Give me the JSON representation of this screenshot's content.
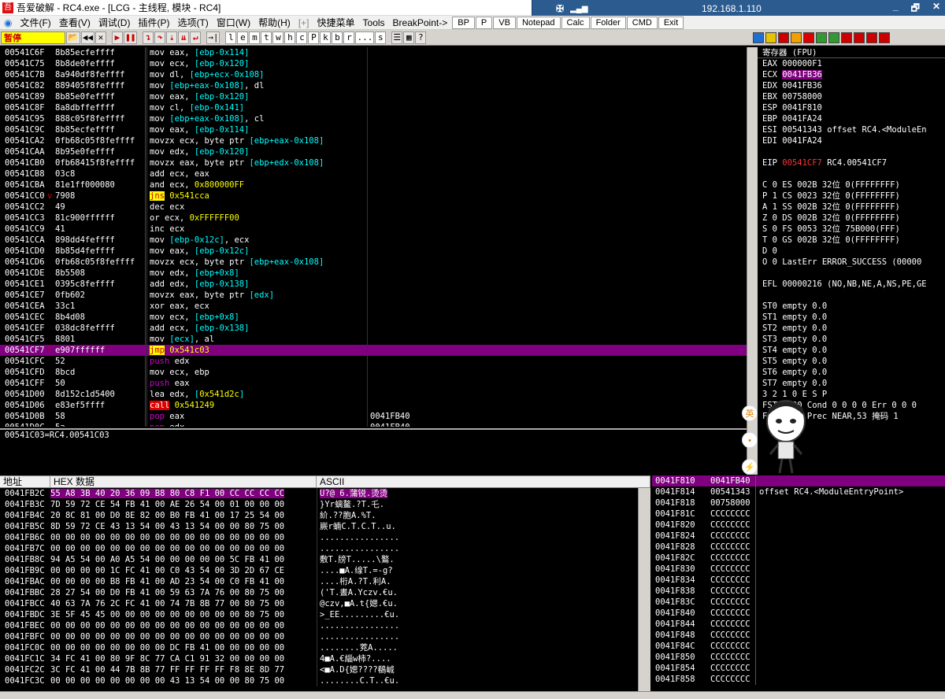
{
  "window": {
    "title": "吾爱破解 - RC4.exe - [LCG - 主线程, 模块 - RC4]",
    "app_icon": "吾"
  },
  "rdp": {
    "pin_icon": "pin-icon",
    "ip": "192.168.1.110",
    "minimize": "_",
    "restore": "🗗",
    "close": "✕"
  },
  "menu": {
    "items": [
      "文件(F)",
      "查看(V)",
      "调试(D)",
      "插件(P)",
      "选项(T)",
      "窗口(W)",
      "帮助(H)",
      "[+]",
      "快捷菜单",
      "Tools",
      "BreakPoint->"
    ],
    "quick_buttons": [
      "BP",
      "P",
      "VB",
      "Notepad",
      "Calc",
      "Folder",
      "CMD",
      "Exit"
    ]
  },
  "toolbar": {
    "status": "暂停",
    "letters": [
      "l",
      "e",
      "m",
      "t",
      "w",
      "h",
      "c",
      "P",
      "k",
      "b",
      "r",
      "...",
      "s"
    ]
  },
  "disasm": [
    {
      "addr": "00541C6F",
      "hex": "8b85ecfeffff",
      "mn": "mov",
      "ops": "eax, [ebp-0x114]"
    },
    {
      "addr": "00541C75",
      "hex": "8b8de0feffff",
      "mn": "mov",
      "ops": "ecx, [ebp-0x120]"
    },
    {
      "addr": "00541C7B",
      "hex": "8a940df8feffff",
      "mn": "mov",
      "ops": "dl, [ebp+ecx-0x108]"
    },
    {
      "addr": "00541C82",
      "hex": "889405f8feffff",
      "mn": "mov",
      "ops": "[ebp+eax-0x108], dl"
    },
    {
      "addr": "00541C89",
      "hex": "8b85e0feffff",
      "mn": "mov",
      "ops": "eax, [ebp-0x120]"
    },
    {
      "addr": "00541C8F",
      "hex": "8a8dbffeffff",
      "mn": "mov",
      "ops": "cl, [ebp-0x141]"
    },
    {
      "addr": "00541C95",
      "hex": "888c05f8feffff",
      "mn": "mov",
      "ops": "[ebp+eax-0x108], cl"
    },
    {
      "addr": "00541C9C",
      "hex": "8b85ecfeffff",
      "mn": "mov",
      "ops": "eax, [ebp-0x114]"
    },
    {
      "addr": "00541CA2",
      "hex": "0fb68c05f8feffff",
      "mn": "movzx",
      "ops": "ecx, byte ptr [ebp+eax-0x108]"
    },
    {
      "addr": "00541CAA",
      "hex": "8b95e0feffff",
      "mn": "mov",
      "ops": "edx, [ebp-0x120]"
    },
    {
      "addr": "00541CB0",
      "hex": "0fb68415f8feffff",
      "mn": "movzx",
      "ops": "eax, byte ptr [ebp+edx-0x108]"
    },
    {
      "addr": "00541CB8",
      "hex": "03c8",
      "mn": "add",
      "ops": "ecx, eax"
    },
    {
      "addr": "00541CBA",
      "hex": "81e1ff000080",
      "mn": "and",
      "ops": "ecx, 0x800000FF"
    },
    {
      "addr": "00541CC0",
      "hex": "7908",
      "mn": "jns",
      "ops": "0x541cca",
      "mark": "v"
    },
    {
      "addr": "00541CC2",
      "hex": "49",
      "mn": "dec",
      "ops": "ecx"
    },
    {
      "addr": "00541CC3",
      "hex": "81c900ffffff",
      "mn": "or",
      "ops": "ecx, 0xFFFFFF00"
    },
    {
      "addr": "00541CC9",
      "hex": "41",
      "mn": "inc",
      "ops": "ecx"
    },
    {
      "addr": "00541CCA",
      "hex": "898dd4feffff",
      "mn": "mov",
      "ops": "[ebp-0x12c], ecx"
    },
    {
      "addr": "00541CD0",
      "hex": "8b85d4feffff",
      "mn": "mov",
      "ops": "eax, [ebp-0x12c]"
    },
    {
      "addr": "00541CD6",
      "hex": "0fb68c05f8feffff",
      "mn": "movzx",
      "ops": "ecx, byte ptr [ebp+eax-0x108]"
    },
    {
      "addr": "00541CDE",
      "hex": "8b5508",
      "mn": "mov",
      "ops": "edx, [ebp+0x8]"
    },
    {
      "addr": "00541CE1",
      "hex": "0395c8feffff",
      "mn": "add",
      "ops": "edx, [ebp-0x138]"
    },
    {
      "addr": "00541CE7",
      "hex": "0fb602",
      "mn": "movzx",
      "ops": "eax, byte ptr [edx]"
    },
    {
      "addr": "00541CEA",
      "hex": "33c1",
      "mn": "xor",
      "ops": "eax, ecx"
    },
    {
      "addr": "00541CEC",
      "hex": "8b4d08",
      "mn": "mov",
      "ops": "ecx, [ebp+0x8]"
    },
    {
      "addr": "00541CEF",
      "hex": "038dc8feffff",
      "mn": "add",
      "ops": "ecx, [ebp-0x138]"
    },
    {
      "addr": "00541CF5",
      "hex": "8801",
      "mn": "mov",
      "ops": "[ecx], al"
    },
    {
      "addr": "00541CF7",
      "hex": "e907ffffff",
      "mn": "jmp",
      "ops": "0x541c03",
      "mark": "^",
      "selected": true
    },
    {
      "addr": "00541CFC",
      "hex": "52",
      "mn": "push",
      "ops": "edx"
    },
    {
      "addr": "00541CFD",
      "hex": "8bcd",
      "mn": "mov",
      "ops": "ecx, ebp"
    },
    {
      "addr": "00541CFF",
      "hex": "50",
      "mn": "push",
      "ops": "eax"
    },
    {
      "addr": "00541D00",
      "hex": "8d152c1d5400",
      "mn": "lea",
      "ops": "edx, [0x541d2c]"
    },
    {
      "addr": "00541D06",
      "hex": "e83ef5ffff",
      "mn": "call",
      "ops": "0x541249"
    },
    {
      "addr": "00541D0B",
      "hex": "58",
      "mn": "pop",
      "ops": "eax",
      "cmt": "0041FB40"
    },
    {
      "addr": "00541D0C",
      "hex": "5a",
      "mn": "pop",
      "ops": "edx",
      "cmt": "0041FB40"
    }
  ],
  "info_line": "00541C03=RC4.00541C03",
  "registers": {
    "header": "寄存器 (FPU)",
    "gp": [
      {
        "name": "EAX",
        "val": "000000F1",
        "note": ""
      },
      {
        "name": "ECX",
        "val": "0041FB36",
        "note": "",
        "hi": true
      },
      {
        "name": "EDX",
        "val": "0041FB36",
        "note": ""
      },
      {
        "name": "EBX",
        "val": "00758000",
        "note": ""
      },
      {
        "name": "ESP",
        "val": "0041F810",
        "note": ""
      },
      {
        "name": "EBP",
        "val": "0041FA24",
        "note": ""
      },
      {
        "name": "ESI",
        "val": "00541343",
        "note": "offset RC4.<ModuleEn"
      },
      {
        "name": "EDI",
        "val": "0041FA24",
        "note": ""
      }
    ],
    "eip": {
      "name": "EIP",
      "val": "00541CF7",
      "note": "RC4.00541CF7"
    },
    "flags": [
      "C 0  ES 002B 32位 0(FFFFFFFF)",
      "P 1  CS 0023 32位 0(FFFFFFFF)",
      "A 1  SS 002B 32位 0(FFFFFFFF)",
      "Z 0  DS 002B 32位 0(FFFFFFFF)",
      "S 0  FS 0053 32位 75B000(FFF)",
      "T 0  GS 002B 32位 0(FFFFFFFF)",
      "D 0",
      "O 0  LastErr ERROR_SUCCESS (00000"
    ],
    "efl": "EFL 00000216 (NO,NB,NE,A,NS,PE,GE",
    "st": [
      "ST0 empty 0.0",
      "ST1 empty 0.0",
      "ST2 empty 0.0",
      "ST3 empty 0.0",
      "ST4 empty 0.0",
      "ST5 empty 0.0",
      "ST6 empty 0.0",
      "ST7 empty 0.0"
    ],
    "fpu_hdr": "             3 2 1 0      E S P",
    "fst": "FST 0000  Cond 0 0 0 0  Err 0 0 0",
    "fcw": "FCW 027F  Prec NEAR,53  掩码    1"
  },
  "dump": {
    "headers": [
      "地址",
      "HEX 数据",
      "ASCII"
    ],
    "rows": [
      {
        "a": "0041FB2C",
        "h": "55 A8 3B 40 20 36 09 B8 80 C8 F1 00 CC CC CC CC",
        "c": "U?@ 6.蒲锐.烫烫",
        "sel": true
      },
      {
        "a": "0041FB3C",
        "h": "7D 59 72 CE 54 FB 41 00 AE 26 54 00 01 00 00 00",
        "c": "}Yr螭鳌.?T.乇."
      },
      {
        "a": "0041FB4C",
        "h": "20 8C 81 00 D0 8E 82 00 B0 FB 41 00 17 25 54 00",
        "c": " 紒.??胞A.%T."
      },
      {
        "a": "0041FB5C",
        "h": "8D 59 72 CE 43 13 54 00 43 13 54 00 00 80 75 00",
        "c": "嶡r蝻C.T.C.T..u."
      },
      {
        "a": "0041FB6C",
        "h": "00 00 00 00 00 00 00 00 00 00 00 00 00 00 00 00",
        "c": "................"
      },
      {
        "a": "0041FB7C",
        "h": "00 00 00 00 00 00 00 00 00 00 00 00 00 00 00 00",
        "c": "................"
      },
      {
        "a": "0041FB8C",
        "h": "94 A5 54 00 A0 A5 54 00 00 00 00 00 5C FB 41 00",
        "c": "敷T.牓T.....\\鸄."
      },
      {
        "a": "0041FB9C",
        "h": "00 00 00 00 1C FC 41 00 C0 43 54 00 3D 2D 67 CE",
        "c": "....■A.缐T.=-g?"
      },
      {
        "a": "0041FBAC",
        "h": "00 00 00 00 B8 FB 41 00 AD 23 54 00 C0 FB 41 00",
        "c": "....桁A.?T.利A."
      },
      {
        "a": "0041FBBC",
        "h": "28 27 54 00 D0 FB 41 00 59 63 7A 76 00 80 75 00",
        "c": "('T.晝A.Yczv.€u."
      },
      {
        "a": "0041FBCC",
        "h": "40 63 7A 76 2C FC 41 00 74 7B 8B 77 00 80 75 00",
        "c": "@czv,■A.t{媤.€u."
      },
      {
        "a": "0041FBDC",
        "h": "3E 5F 45 45 00 00 00 00 00 00 00 00 00 80 75 00",
        "c": ">_EE.........€u."
      },
      {
        "a": "0041FBEC",
        "h": "00 00 00 00 00 00 00 00 00 00 00 00 00 00 00 00",
        "c": "................"
      },
      {
        "a": "0041FBFC",
        "h": "00 00 00 00 00 00 00 00 00 00 00 00 00 00 00 00",
        "c": "................"
      },
      {
        "a": "0041FC0C",
        "h": "00 00 00 00 00 00 00 00 DC FB 41 00 00 00 00 00",
        "c": "........茺A....."
      },
      {
        "a": "0041FC1C",
        "h": "34 FC 41 00 80 9F 8C 77 CA C1 91 32 00 00 00 00",
        "c": "4■A.€緇w柿?...."
      },
      {
        "a": "0041FC2C",
        "h": "3C FC 41 00 44 7B 8B 77 FF FF FF FF F8 8E 8D 77",
        "c": "<■A.D{媤????鵗峸"
      },
      {
        "a": "0041FC3C",
        "h": "00 00 00 00 00 00 00 00 43 13 54 00 00 80 75 00",
        "c": "........C.T..€u."
      }
    ]
  },
  "stack": [
    {
      "a": "0041F810",
      "v": "0041FB40",
      "c": "",
      "top": true
    },
    {
      "a": "0041F814",
      "v": "00541343",
      "c": "offset RC4.<ModuleEntryPoint>"
    },
    {
      "a": "0041F818",
      "v": "00758000",
      "c": ""
    },
    {
      "a": "0041F81C",
      "v": "CCCCCCCC",
      "c": ""
    },
    {
      "a": "0041F820",
      "v": "CCCCCCCC",
      "c": ""
    },
    {
      "a": "0041F824",
      "v": "CCCCCCCC",
      "c": ""
    },
    {
      "a": "0041F828",
      "v": "CCCCCCCC",
      "c": ""
    },
    {
      "a": "0041F82C",
      "v": "CCCCCCCC",
      "c": ""
    },
    {
      "a": "0041F830",
      "v": "CCCCCCCC",
      "c": ""
    },
    {
      "a": "0041F834",
      "v": "CCCCCCCC",
      "c": ""
    },
    {
      "a": "0041F838",
      "v": "CCCCCCCC",
      "c": ""
    },
    {
      "a": "0041F83C",
      "v": "CCCCCCCC",
      "c": ""
    },
    {
      "a": "0041F840",
      "v": "CCCCCCCC",
      "c": ""
    },
    {
      "a": "0041F844",
      "v": "CCCCCCCC",
      "c": ""
    },
    {
      "a": "0041F848",
      "v": "CCCCCCCC",
      "c": ""
    },
    {
      "a": "0041F84C",
      "v": "CCCCCCCC",
      "c": ""
    },
    {
      "a": "0041F850",
      "v": "CCCCCCCC",
      "c": ""
    },
    {
      "a": "0041F854",
      "v": "CCCCCCCC",
      "c": ""
    },
    {
      "a": "0041F858",
      "v": "CCCCCCCC",
      "c": ""
    }
  ],
  "mascot": {
    "bubbles": [
      "英",
      "•",
      "⚡"
    ]
  }
}
